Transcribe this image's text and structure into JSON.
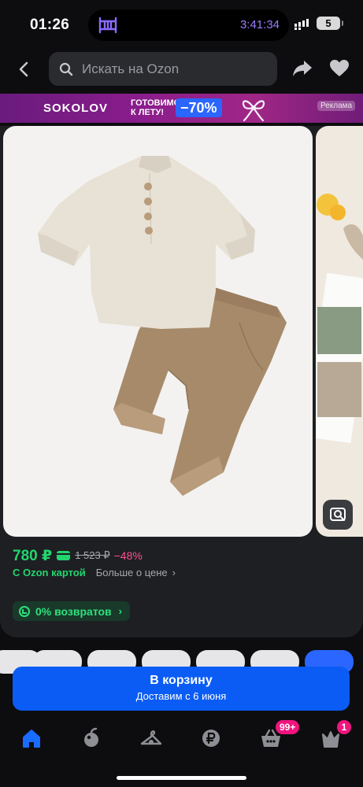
{
  "status_bar": {
    "time": "01:26",
    "timer": "3:41:34",
    "battery": "5",
    "icons": [
      "crib-icon",
      "signal-icon"
    ]
  },
  "search": {
    "placeholder": "Искать на Ozon"
  },
  "banner": {
    "brand": "SOKOLOV",
    "promo": "ГОТОВИМСЯ К ЛЕТУ!",
    "discount": "−70%",
    "ad_label": "Реклама"
  },
  "product": {
    "price": "780 ₽",
    "old_price": "1 523 ₽",
    "discount": "−48%",
    "ozon_card_label": "С Ozon картой",
    "more_price_label": "Больше о цене",
    "more_price_chevron": "›",
    "returns_label": "0% возвратов",
    "returns_chevron": "›"
  },
  "cart_button": {
    "label": "В корзину",
    "delivery": "Доставим с 6 июня"
  },
  "tabbar": {
    "items": [
      {
        "icon": "home-icon",
        "active": true
      },
      {
        "icon": "fresh-icon",
        "active": false
      },
      {
        "icon": "hanger-icon",
        "active": false
      },
      {
        "icon": "ruble-icon",
        "active": false
      },
      {
        "icon": "cart-icon",
        "active": false,
        "badge": "99+"
      },
      {
        "icon": "crown-icon",
        "active": false,
        "badge": "1"
      }
    ]
  },
  "colors": {
    "accent_blue": "#0a5cf5",
    "price_green": "#22d66f",
    "discount_pink": "#ff4f8b",
    "badge_pink": "#f0147e"
  }
}
